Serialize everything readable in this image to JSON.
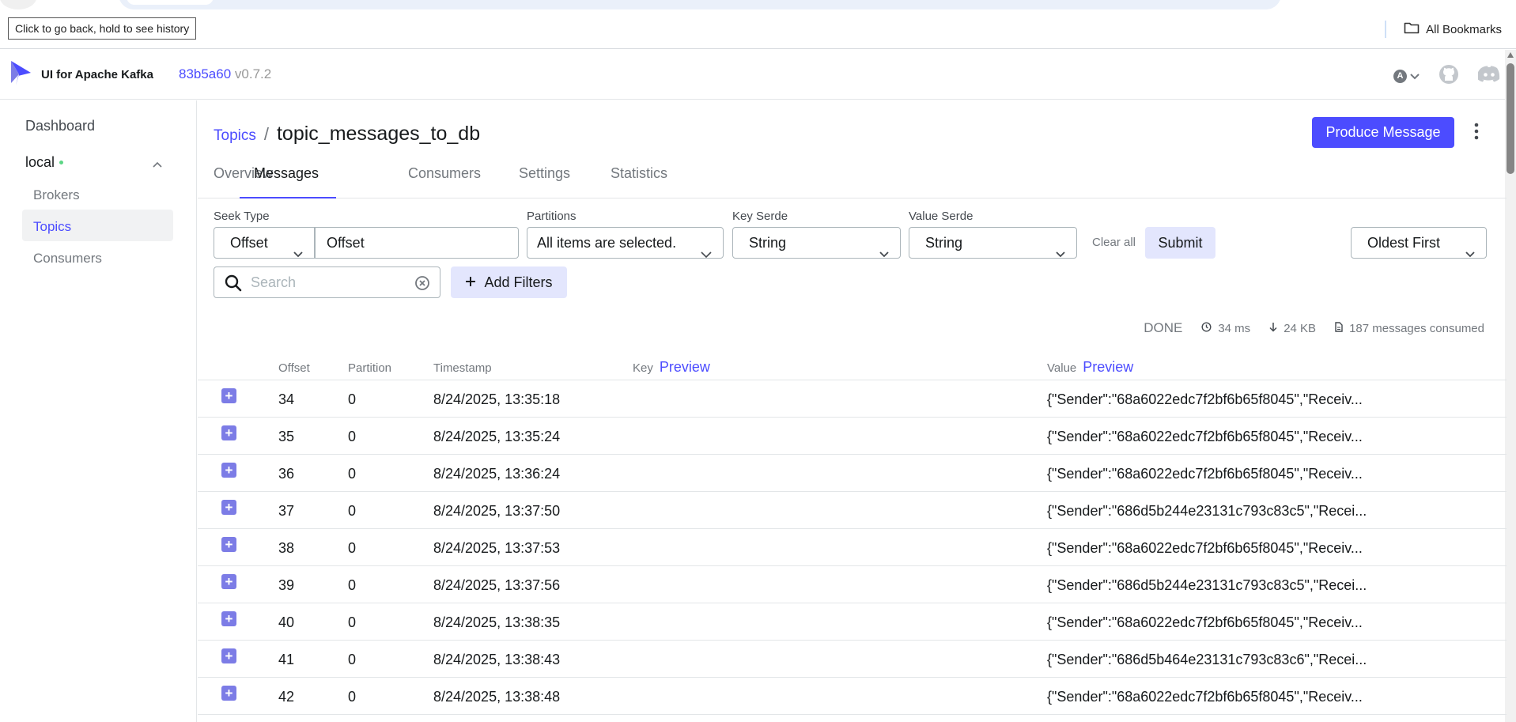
{
  "browser": {
    "tooltip": "Click to go back, hold to see history",
    "bookmarks_label": "All Bookmarks"
  },
  "header": {
    "app_title": "UI for Apache Kafka",
    "commit": "83b5a60",
    "version": "v0.7.2",
    "lang": "A"
  },
  "sidebar": {
    "dashboard": "Dashboard",
    "cluster": "local",
    "items": [
      "Brokers",
      "Topics",
      "Consumers"
    ],
    "active_item": "Topics"
  },
  "breadcrumb": {
    "parent": "Topics",
    "separator": "/",
    "title": "topic_messages_to_db"
  },
  "actions": {
    "produce": "Produce Message"
  },
  "tabs": [
    "Overview",
    "Messages",
    "Consumers",
    "Settings",
    "Statistics"
  ],
  "active_tab": "Messages",
  "filters": {
    "seek_type_label": "Seek Type",
    "seek_type_value": "Offset",
    "offset_value": "Offset",
    "partitions_label": "Partitions",
    "partitions_value": "All items are selected.",
    "key_serde_label": "Key Serde",
    "key_serde_value": "String",
    "value_serde_label": "Value Serde",
    "value_serde_value": "String",
    "clear_all": "Clear all",
    "submit": "Submit",
    "sort_value": "Oldest First",
    "search_placeholder": "Search",
    "add_filters": "Add Filters"
  },
  "status": {
    "state": "DONE",
    "elapsed": "34 ms",
    "bytes": "24 KB",
    "consumed": "187 messages consumed"
  },
  "table": {
    "columns": {
      "offset": "Offset",
      "partition": "Partition",
      "timestamp": "Timestamp",
      "key": "Key",
      "value": "Value",
      "preview": "Preview"
    },
    "rows": [
      {
        "offset": "34",
        "partition": "0",
        "timestamp": "8/24/2025, 13:35:18",
        "value": "{\"Sender\":\"68a6022edc7f2bf6b65f8045\",\"Receiv..."
      },
      {
        "offset": "35",
        "partition": "0",
        "timestamp": "8/24/2025, 13:35:24",
        "value": "{\"Sender\":\"68a6022edc7f2bf6b65f8045\",\"Receiv..."
      },
      {
        "offset": "36",
        "partition": "0",
        "timestamp": "8/24/2025, 13:36:24",
        "value": "{\"Sender\":\"68a6022edc7f2bf6b65f8045\",\"Receiv..."
      },
      {
        "offset": "37",
        "partition": "0",
        "timestamp": "8/24/2025, 13:37:50",
        "value": "{\"Sender\":\"686d5b244e23131c793c83c5\",\"Recei..."
      },
      {
        "offset": "38",
        "partition": "0",
        "timestamp": "8/24/2025, 13:37:53",
        "value": "{\"Sender\":\"68a6022edc7f2bf6b65f8045\",\"Receiv..."
      },
      {
        "offset": "39",
        "partition": "0",
        "timestamp": "8/24/2025, 13:37:56",
        "value": "{\"Sender\":\"686d5b244e23131c793c83c5\",\"Recei..."
      },
      {
        "offset": "40",
        "partition": "0",
        "timestamp": "8/24/2025, 13:38:35",
        "value": "{\"Sender\":\"68a6022edc7f2bf6b65f8045\",\"Receiv..."
      },
      {
        "offset": "41",
        "partition": "0",
        "timestamp": "8/24/2025, 13:38:43",
        "value": "{\"Sender\":\"686d5b464e23131c793c83c6\",\"Recei..."
      },
      {
        "offset": "42",
        "partition": "0",
        "timestamp": "8/24/2025, 13:38:48",
        "value": "{\"Sender\":\"68a6022edc7f2bf6b65f8045\",\"Receiv..."
      }
    ]
  },
  "colors": {
    "accent": "#4c4cff",
    "accent_soft": "#e3e6fd",
    "plus": "#7c7ce6",
    "online": "#5cd685"
  },
  "icons": {
    "logo": "kafka-logo-icon",
    "github": "github-icon",
    "discord": "discord-icon",
    "folder": "folder-icon",
    "search": "search-icon",
    "clear": "clear-circle-icon",
    "plus": "plus-icon",
    "clock": "clock-icon",
    "download": "arrow-down-icon",
    "file": "file-icon",
    "kebab": "kebab-menu-icon"
  }
}
